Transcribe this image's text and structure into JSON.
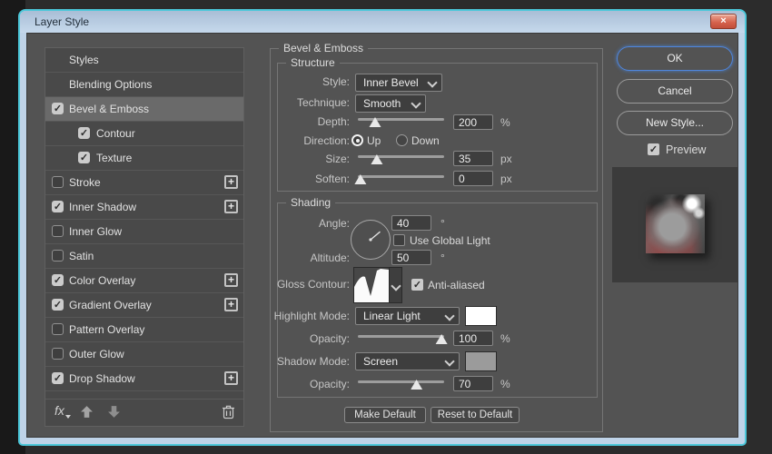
{
  "window": {
    "title": "Layer Style"
  },
  "icons": {
    "close": "×",
    "plus": "+"
  },
  "colors": {
    "accent_cyan": "#4cc7d9",
    "frame": "#bfd3e8",
    "client_bg": "#535353",
    "panel_bg": "#494949",
    "selected_row": "#6a6a6a",
    "input_bg": "#3e3e3e",
    "close_red": "#d4604b",
    "ok_border": "#4f86de"
  },
  "sidebar": {
    "items": [
      {
        "label": "Styles"
      },
      {
        "label": "Blending Options"
      },
      {
        "label": "Bevel & Emboss",
        "checked": true,
        "selected": true
      },
      {
        "label": "Contour",
        "checked": true,
        "indent": true
      },
      {
        "label": "Texture",
        "checked": true,
        "indent": true
      },
      {
        "label": "Stroke",
        "checked": false,
        "plus": true
      },
      {
        "label": "Inner Shadow",
        "checked": true,
        "plus": true
      },
      {
        "label": "Inner Glow",
        "checked": false
      },
      {
        "label": "Satin",
        "checked": false
      },
      {
        "label": "Color Overlay",
        "checked": true,
        "plus": true
      },
      {
        "label": "Gradient Overlay",
        "checked": true,
        "plus": true
      },
      {
        "label": "Pattern Overlay",
        "checked": false
      },
      {
        "label": "Outer Glow",
        "checked": false
      },
      {
        "label": "Drop Shadow",
        "checked": true,
        "plus": true
      }
    ],
    "footer": {
      "fx_label": "fx"
    }
  },
  "main": {
    "title": "Bevel & Emboss",
    "structure": {
      "legend": "Structure",
      "style": {
        "label": "Style:",
        "value": "Inner Bevel"
      },
      "technique": {
        "label": "Technique:",
        "value": "Smooth"
      },
      "depth": {
        "label": "Depth:",
        "value": "200",
        "unit": "%",
        "slider_pct": 20
      },
      "direction": {
        "label": "Direction:",
        "up_label": "Up",
        "down_label": "Down",
        "up_on": true,
        "down_on": false
      },
      "size": {
        "label": "Size:",
        "value": "35",
        "unit": "px",
        "slider_pct": 22
      },
      "soften": {
        "label": "Soften:",
        "value": "0",
        "unit": "px",
        "slider_pct": 3
      }
    },
    "shading": {
      "legend": "Shading",
      "angle": {
        "label": "Angle:",
        "value": "40",
        "unit": "°"
      },
      "use_global_light": {
        "label": "Use Global Light",
        "checked": false
      },
      "altitude": {
        "label": "Altitude:",
        "value": "50",
        "unit": "°"
      },
      "gloss_contour": {
        "label": "Gloss Contour:"
      },
      "anti_aliased": {
        "label": "Anti-aliased",
        "checked": true
      },
      "highlight_mode": {
        "label": "Highlight Mode:",
        "value": "Linear Light",
        "swatch": "#ffffff"
      },
      "highlight_opacity": {
        "label": "Opacity:",
        "value": "100",
        "unit": "%",
        "slider_pct": 97
      },
      "shadow_mode": {
        "label": "Shadow Mode:",
        "value": "Screen",
        "swatch": "#9b9b9b"
      },
      "shadow_opacity": {
        "label": "Opacity:",
        "value": "70",
        "unit": "%",
        "slider_pct": 68
      }
    },
    "footer": {
      "make_default": "Make Default",
      "reset_to_default": "Reset to Default"
    }
  },
  "actions": {
    "ok": "OK",
    "cancel": "Cancel",
    "new_style": "New Style...",
    "preview": {
      "label": "Preview",
      "checked": true
    }
  }
}
